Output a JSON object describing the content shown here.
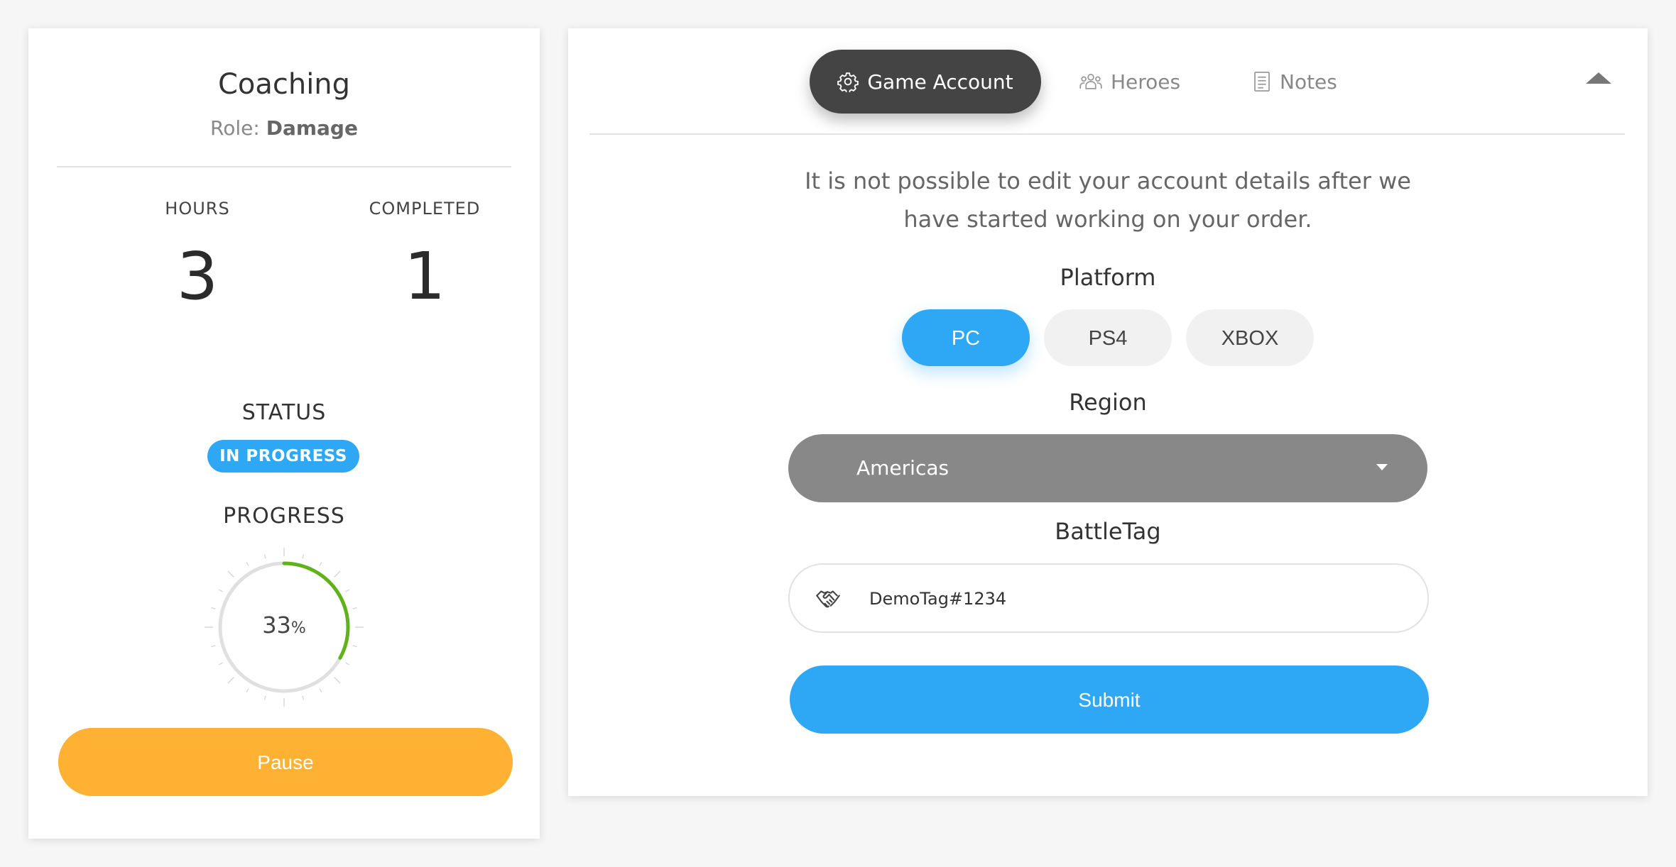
{
  "summary": {
    "title": "Coaching",
    "role_label": "Role:",
    "role_value": "Damage",
    "hours_label": "HOURS",
    "hours_value": "3",
    "completed_label": "COMPLETED",
    "completed_value": "1",
    "status_label": "STATUS",
    "status_badge": "IN PROGRESS",
    "progress_label": "PROGRESS",
    "progress_value": "33",
    "progress_unit": "%",
    "progress_fraction": 0.33,
    "pause_label": "Pause"
  },
  "tabs": [
    {
      "label": "Game Account",
      "icon": "gear-icon",
      "active": true
    },
    {
      "label": "Heroes",
      "icon": "users-icon",
      "active": false
    },
    {
      "label": "Notes",
      "icon": "notes-icon",
      "active": false
    }
  ],
  "account_form": {
    "notice": "It is not possible to edit your account details after we have started working on your order.",
    "platform_label": "Platform",
    "platforms": [
      "PC",
      "PS4",
      "XBOX"
    ],
    "selected_platform": "PC",
    "region_label": "Region",
    "region_value": "Americas",
    "battletag_label": "BattleTag",
    "battletag_value": "DemoTag#1234",
    "battletag_icon": "handshake-icon",
    "submit_label": "Submit"
  },
  "colors": {
    "accent": "#2ea8f5",
    "pause": "#feb133",
    "progress": "#5fb319",
    "tab_active_bg": "#444444",
    "select_bg": "#888888"
  }
}
